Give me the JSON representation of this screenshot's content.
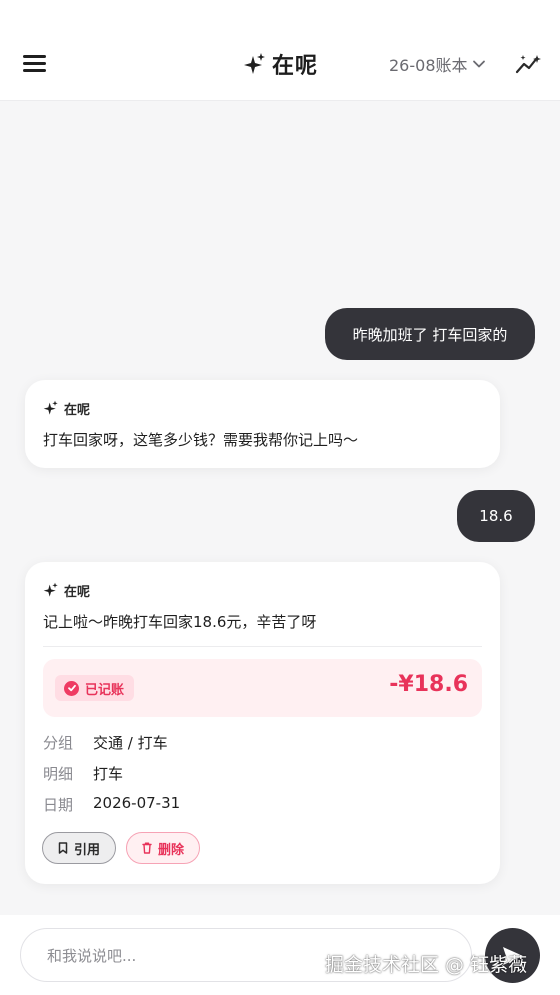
{
  "header": {
    "title": "在呢",
    "ledger_label": "26-08账本",
    "menu_icon": "hamburger-menu-icon",
    "sparkle_icon": "sparkle-icon",
    "trend_icon": "trend-chart-icon"
  },
  "messages": {
    "user_1": "昨晚加班了 打车回家的",
    "bot_1": {
      "name": "在呢",
      "text": "打车回家呀，这笔多少钱？需要我帮你记上吗～"
    },
    "user_2": "18.6",
    "bot_2": {
      "name": "在呢",
      "text": "记上啦～昨晚打车回家18.6元，辛苦了呀",
      "record": {
        "badge": "已记账",
        "amount": "-¥18.6",
        "fields": [
          {
            "key": "分组",
            "value": "交通 / 打车"
          },
          {
            "key": "明细",
            "value": "打车"
          },
          {
            "key": "日期",
            "value": "2026-07-31"
          }
        ]
      },
      "actions": {
        "quote": "引用",
        "delete": "删除"
      }
    }
  },
  "composer": {
    "placeholder": "和我说说吧..."
  },
  "watermark": "掘金技术社区 @ 钰紫薇",
  "colors": {
    "accent": "#e8335a",
    "dark": "#34343a",
    "record_bg": "#fff0f2"
  }
}
